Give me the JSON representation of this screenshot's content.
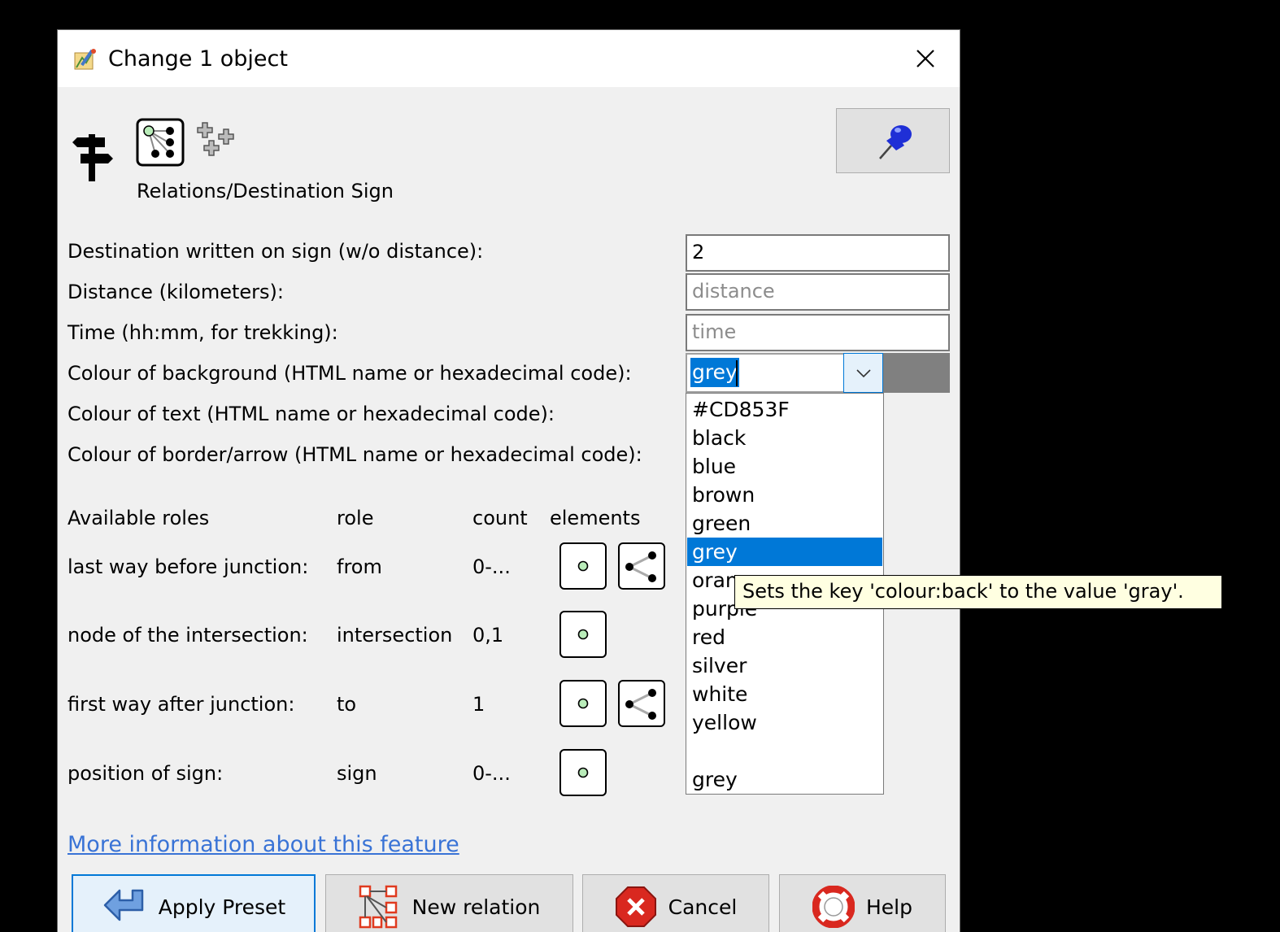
{
  "window": {
    "title": "Change 1 object"
  },
  "preset": {
    "name": "Relations/Destination Sign"
  },
  "fields": [
    {
      "label": "Destination written on sign (w/o distance):",
      "value": "2",
      "placeholder": ""
    },
    {
      "label": "Distance (kilometers):",
      "value": "",
      "placeholder": "distance"
    },
    {
      "label": "Time (hh:mm, for trekking):",
      "value": "",
      "placeholder": "time"
    },
    {
      "label": "Colour of background (HTML name or hexadecimal code):",
      "value": "grey"
    },
    {
      "label": "Colour of text (HTML name or hexadecimal code):"
    },
    {
      "label": "Colour of border/arrow (HTML name or hexadecimal code):"
    }
  ],
  "colour_background": {
    "value": "grey",
    "swatch_color": "#808080",
    "options": [
      "#CD853F",
      "black",
      "blue",
      "brown",
      "green",
      "grey",
      "orange",
      "purple",
      "red",
      "silver",
      "white",
      "yellow",
      "",
      "grey"
    ],
    "selected_index": 5
  },
  "tooltip": {
    "text": "Sets the key 'colour:back' to the value 'gray'."
  },
  "roles": {
    "headers": {
      "available": "Available roles",
      "role": "role",
      "count": "count",
      "elements": "elements"
    },
    "rows": [
      {
        "label": "last way before junction:",
        "role": "from",
        "count": "0-...",
        "elements": [
          "node-icon",
          "way-icon"
        ]
      },
      {
        "label": "node of the intersection:",
        "role": "intersection",
        "count": "0,1",
        "elements": [
          "node-icon"
        ]
      },
      {
        "label": "first way after junction:",
        "role": "to",
        "count": "1",
        "elements": [
          "node-icon",
          "way-icon"
        ]
      },
      {
        "label": "position of sign:",
        "role": "sign",
        "count": "0-...",
        "elements": [
          "node-icon"
        ]
      }
    ]
  },
  "more_info": {
    "label": "More information about this feature"
  },
  "buttons": {
    "apply": "Apply Preset",
    "new_relation": "New relation",
    "cancel": "Cancel",
    "help": "Help"
  },
  "colors": {
    "accent": "#0078d7",
    "link": "#3973d6",
    "tooltip_bg": "#ffffe1",
    "dialog_bg": "#f0f0f0"
  }
}
